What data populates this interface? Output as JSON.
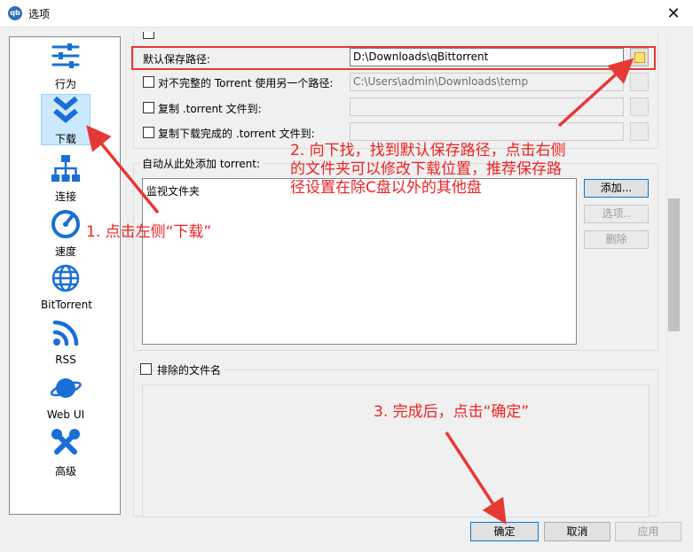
{
  "window": {
    "title": "选项",
    "app_icon_text": "qb",
    "close_glyph": "✕"
  },
  "sidebar": {
    "items": [
      {
        "label": "行为",
        "icon": "sliders-icon"
      },
      {
        "label": "下载",
        "icon": "double-chevron-down-icon",
        "selected": true
      },
      {
        "label": "连接",
        "icon": "network-icon"
      },
      {
        "label": "速度",
        "icon": "gauge-icon"
      },
      {
        "label": "BitTorrent",
        "icon": "globe-icon"
      },
      {
        "label": "RSS",
        "icon": "rss-icon"
      },
      {
        "label": "Web UI",
        "icon": "planet-icon"
      },
      {
        "label": "高级",
        "icon": "tools-icon"
      }
    ]
  },
  "downloads": {
    "default_save_path_label": "默认保存路径:",
    "default_save_path_value": "D:\\Downloads\\qBittorrent",
    "incomplete_label": "对不完整的 Torrent 使用另一个路径:",
    "incomplete_value": "C:\\Users\\admin\\Downloads\\temp",
    "copy_torrent_label": "复制 .torrent 文件到:",
    "copy_finished_label": "复制下载完成的 .torrent 文件到:",
    "auto_add_group_label": "自动从此处添加 torrent:",
    "watch_folder_header": "监视文件夹",
    "add_button": "添加...",
    "options_button": "选项..",
    "remove_button": "删除",
    "excluded_files_label": "排除的文件名"
  },
  "footer": {
    "ok": "确定",
    "cancel": "取消",
    "apply": "应用"
  },
  "annotations": {
    "step1": "1. 点击左侧“下载”",
    "step2_line1": "2. 向下找，找到默认保存路径，点击右侧",
    "step2_line2": "的文件夹可以修改下载位置，推荐保存路",
    "step2_line3": "径设置在除C盘以外的其他盘",
    "step3": "3. 完成后，点击“确定”"
  },
  "colors": {
    "accent": "#0078d7",
    "annotation_red": "#ee2222",
    "selected_bg": "#cce8ff",
    "icon_blue": "#1a6fd6"
  }
}
